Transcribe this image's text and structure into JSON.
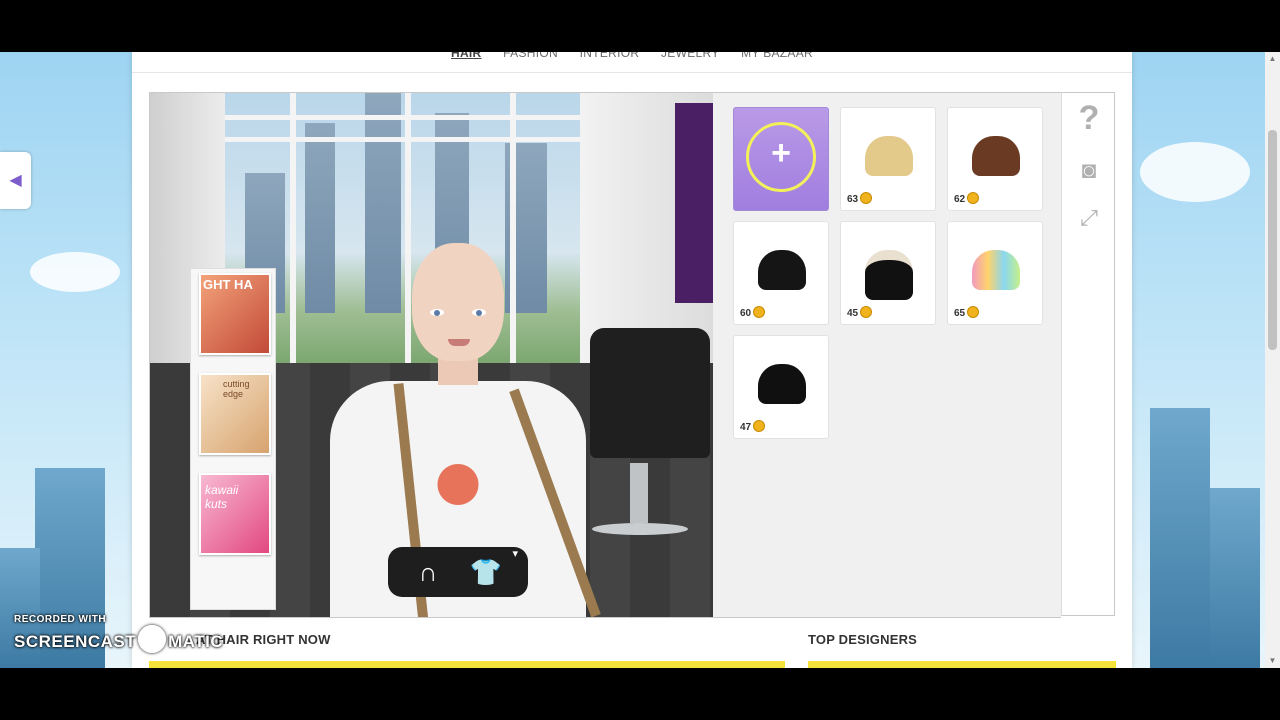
{
  "topnav": {
    "items": [
      "HAIR",
      "FASHION",
      "INTERIOR",
      "JEWELRY",
      "MY BAZAAR"
    ],
    "active": "HAIR"
  },
  "magazines": [
    "GHT HA",
    "cutting edge",
    "kawaii kuts"
  ],
  "tiles": [
    {
      "price": "",
      "icon": "add-plus-icon"
    },
    {
      "price": "63",
      "color": "#e3c98a"
    },
    {
      "price": "62",
      "color": "#6b3a22"
    },
    {
      "price": "60",
      "color": "#151515"
    },
    {
      "price": "45",
      "color": "#111111"
    },
    {
      "price": "65",
      "color": "#f19ac0"
    },
    {
      "price": "47",
      "color": "#101010"
    }
  ],
  "side_tools": [
    "help-icon",
    "camera-icon",
    "fullscreen-icon"
  ],
  "sections": {
    "left_heading": "HOT HAIR RIGHT NOW",
    "left_heading_visible": "AT HAIR RIGHT NOW",
    "right_heading": "TOP DESIGNERS"
  },
  "watermark": {
    "line1": "RECORDED WITH",
    "line2a": "SCREENCAST",
    "line2b": "MATIC"
  },
  "colors": {
    "accent_purple": "#a07ee0",
    "coin": "#f0b21d",
    "highlight_ring": "#f3f05a"
  }
}
